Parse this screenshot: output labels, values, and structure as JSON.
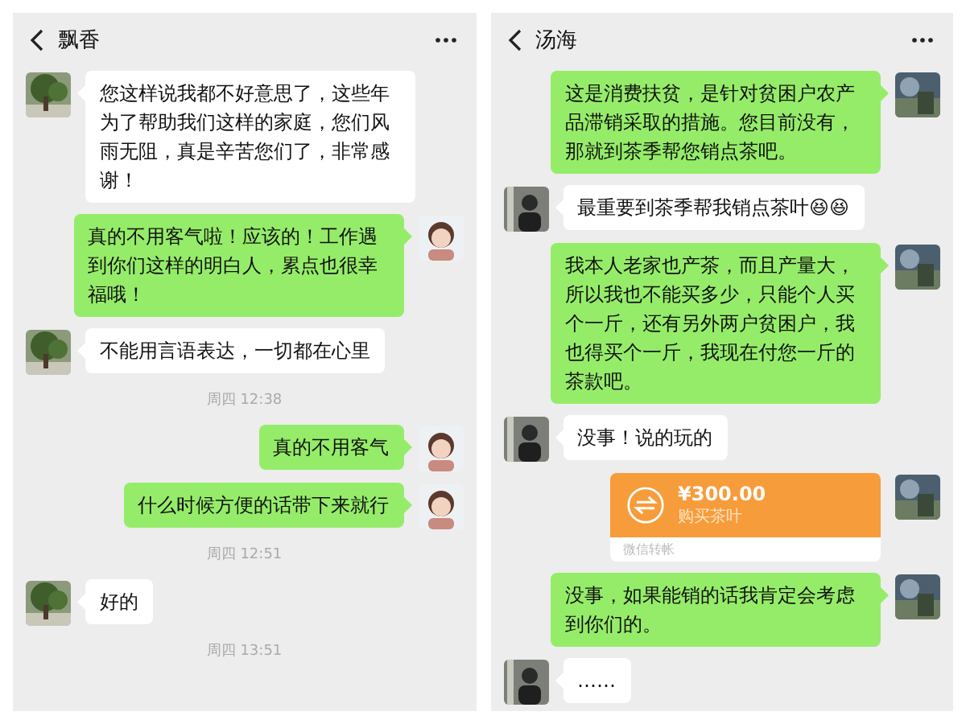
{
  "chats": [
    {
      "title": "飘香",
      "messages": [
        {
          "kind": "received",
          "text": "您这样说我都不好意思了，这些年为了帮助我们这样的家庭，您们风雨无阻，真是辛苦您们了，非常感谢！"
        },
        {
          "kind": "sent",
          "text": "真的不用客气啦！应该的！工作遇到你们这样的明白人，累点也很幸福哦！"
        },
        {
          "kind": "received",
          "text": "不能用言语表达，一切都在心里"
        },
        {
          "kind": "time",
          "text": "周四 12:38"
        },
        {
          "kind": "sent",
          "text": "真的不用客气"
        },
        {
          "kind": "sent",
          "text": "什么时候方便的话带下来就行"
        },
        {
          "kind": "time",
          "text": "周四 12:51"
        },
        {
          "kind": "received",
          "text": "好的"
        },
        {
          "kind": "time",
          "text": "周四 13:51"
        }
      ]
    },
    {
      "title": "汤海",
      "messages": [
        {
          "kind": "sent",
          "text": "这是消费扶贫，是针对贫困户农产品滞销采取的措施。您目前没有，那就到茶季帮您销点茶吧。"
        },
        {
          "kind": "received",
          "text": "最重要到茶季帮我销点茶叶😆😆"
        },
        {
          "kind": "sent",
          "text": "我本人老家也产茶，而且产量大，所以我也不能买多少，只能个人买个一斤，还有另外两户贫困户，我也得买个一斤，我现在付您一斤的茶款吧。"
        },
        {
          "kind": "received",
          "text": "没事！说的玩的"
        },
        {
          "kind": "transfer",
          "amount": "¥300.00",
          "note": "购买茶叶",
          "footer": "微信转帐"
        },
        {
          "kind": "sent",
          "text": "没事，如果能销的话我肯定会考虑到你们的。"
        },
        {
          "kind": "received",
          "text": "……"
        }
      ]
    }
  ]
}
